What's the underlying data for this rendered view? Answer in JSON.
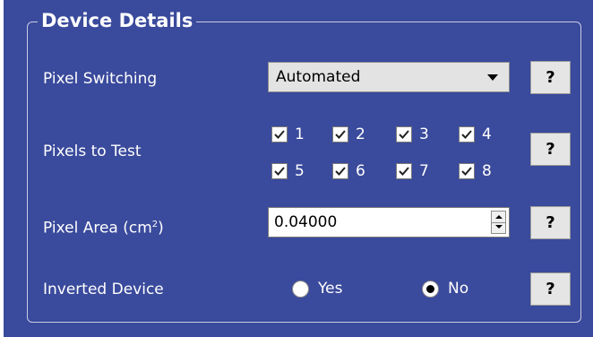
{
  "group": {
    "title": "Device Details"
  },
  "pixel_switching": {
    "label": "Pixel Switching",
    "selected": "Automated"
  },
  "pixels_to_test": {
    "label": "Pixels to Test",
    "items": [
      {
        "label": "1",
        "checked": true
      },
      {
        "label": "2",
        "checked": true
      },
      {
        "label": "3",
        "checked": true
      },
      {
        "label": "4",
        "checked": true
      },
      {
        "label": "5",
        "checked": true
      },
      {
        "label": "6",
        "checked": true
      },
      {
        "label": "7",
        "checked": true
      },
      {
        "label": "8",
        "checked": true
      }
    ]
  },
  "pixel_area": {
    "label_prefix": "Pixel Area (cm",
    "label_sup": "2",
    "label_suffix": ")",
    "value": "0.04000"
  },
  "inverted_device": {
    "label": "Inverted Device",
    "options": [
      {
        "label": "Yes",
        "selected": false
      },
      {
        "label": "No",
        "selected": true
      }
    ]
  },
  "help": {
    "label": "?"
  },
  "colors": {
    "panel_bg": "#3a4a9c",
    "text": "#ffffff",
    "button_bg": "#e5e5e5"
  }
}
